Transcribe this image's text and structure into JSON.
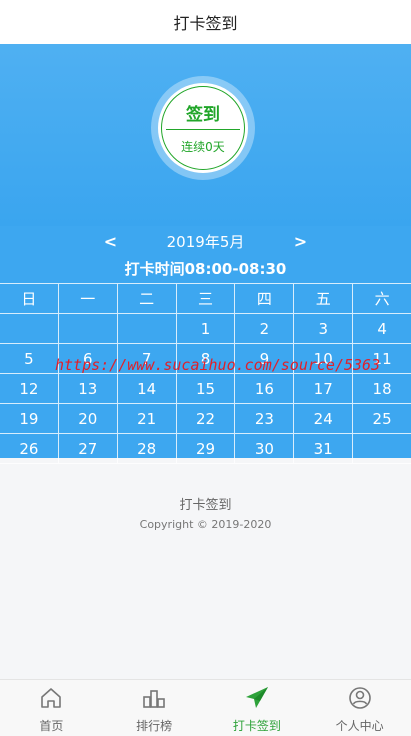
{
  "header": {
    "title": "打卡签到"
  },
  "badge": {
    "title": "签到",
    "subtitle": "连续0天"
  },
  "calendar": {
    "prev": "<",
    "next": ">",
    "month": "2019年5月",
    "hours": "打卡时间08:00-08:30",
    "weekdays": [
      "日",
      "一",
      "二",
      "三",
      "四",
      "五",
      "六"
    ],
    "weeks": [
      [
        "",
        "",
        "",
        "1",
        "2",
        "3",
        "4"
      ],
      [
        "5",
        "6",
        "7",
        "8",
        "9",
        "10",
        "11"
      ],
      [
        "12",
        "13",
        "14",
        "15",
        "16",
        "17",
        "18"
      ],
      [
        "19",
        "20",
        "21",
        "22",
        "23",
        "24",
        "25"
      ],
      [
        "26",
        "27",
        "28",
        "29",
        "30",
        "31",
        ""
      ]
    ]
  },
  "watermark": "https://www.sucaihuo.com/source/5363",
  "footer": {
    "title": "打卡签到",
    "copyright": "Copyright © 2019-2020"
  },
  "tabs": [
    {
      "label": "首页",
      "icon": "home-icon"
    },
    {
      "label": "排行榜",
      "icon": "ranking-icon"
    },
    {
      "label": "打卡签到",
      "icon": "paper-plane-icon",
      "active": true
    },
    {
      "label": "个人中心",
      "icon": "user-icon"
    }
  ],
  "colors": {
    "primary": "#3da7f0",
    "accent": "#22a62a"
  }
}
